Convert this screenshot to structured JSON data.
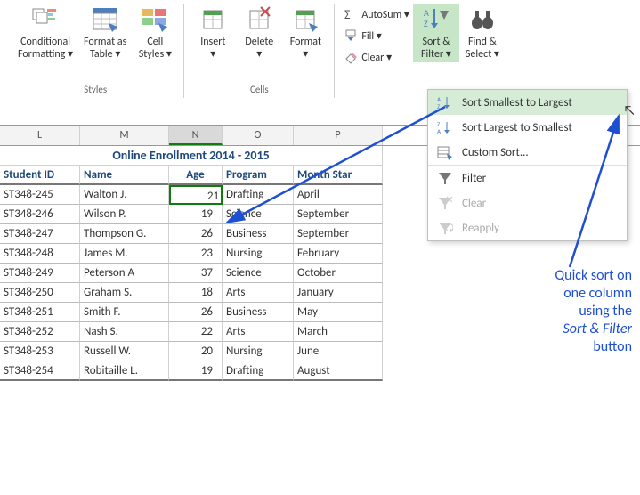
{
  "ribbon": {
    "styles": {
      "conditional": "Conditional\nFormatting ▾",
      "format_table": "Format as\nTable ▾",
      "cell_styles": "Cell\nStyles ▾",
      "group_label": "Styles"
    },
    "cells": {
      "insert": "Insert\n▾",
      "delete": "Delete\n▾",
      "format": "Format\n▾",
      "group_label": "Cells"
    },
    "editing": {
      "autosum": "AutoSum ▾",
      "fill": "Fill ▾",
      "clear": "Clear ▾",
      "sort_filter": "Sort &\nFilter ▾",
      "find_select": "Find &\nSelect ▾"
    }
  },
  "menu": {
    "sort_asc": "Sort Smallest to Largest",
    "sort_desc": "Sort Largest to Smallest",
    "custom_sort": "Custom Sort...",
    "filter": "Filter",
    "clear": "Clear",
    "reapply": "Reapply"
  },
  "columns": {
    "L": "L",
    "M": "M",
    "N": "N",
    "O": "O",
    "P": "P"
  },
  "sheet": {
    "title": "Online Enrollment 2014 - 2015",
    "headers": {
      "id": "Student ID",
      "name": "Name",
      "age": "Age",
      "program": "Program",
      "month": "Month Star"
    },
    "rows": [
      {
        "id": "ST348-245",
        "name": "Walton J.",
        "age": "21",
        "program": "Drafting",
        "month": "April"
      },
      {
        "id": "ST348-246",
        "name": "Wilson P.",
        "age": "19",
        "program": "Science",
        "month": "September"
      },
      {
        "id": "ST348-247",
        "name": "Thompson G.",
        "age": "26",
        "program": "Business",
        "month": "September"
      },
      {
        "id": "ST348-248",
        "name": "James M.",
        "age": "23",
        "program": "Nursing",
        "month": "February"
      },
      {
        "id": "ST348-249",
        "name": "Peterson A",
        "age": "37",
        "program": "Science",
        "month": "October"
      },
      {
        "id": "ST348-250",
        "name": "Graham S.",
        "age": "18",
        "program": "Arts",
        "month": "January"
      },
      {
        "id": "ST348-251",
        "name": "Smith F.",
        "age": "26",
        "program": "Business",
        "month": "May"
      },
      {
        "id": "ST348-252",
        "name": "Nash S.",
        "age": "22",
        "program": "Arts",
        "month": "March"
      },
      {
        "id": "ST348-253",
        "name": "Russell W.",
        "age": "20",
        "program": "Nursing",
        "month": "June"
      },
      {
        "id": "ST348-254",
        "name": "Robitaille L.",
        "age": "19",
        "program": "Drafting",
        "month": "August"
      }
    ]
  },
  "annotation": {
    "l1": "Quick sort on",
    "l2": "one column",
    "l3": "using the",
    "l4": "Sort & Filter",
    "l5": "button"
  }
}
